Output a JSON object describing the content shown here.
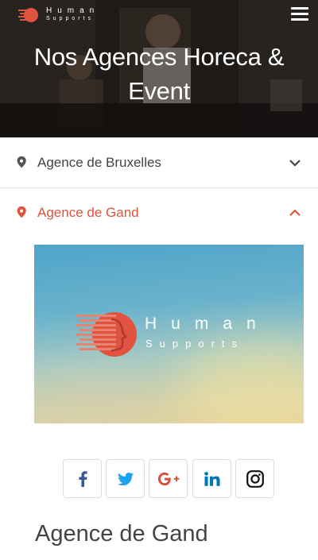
{
  "header": {
    "brand_line1": "Human",
    "brand_line2": "Supports",
    "title_line1": "Nos Agences Horeca &",
    "title_line2": "Event"
  },
  "accordion": [
    {
      "label": "Agence de Bruxelles",
      "state": "collapsed"
    },
    {
      "label": "Agence de Gand",
      "state": "expanded"
    }
  ],
  "panel": {
    "brand_line1": "Human",
    "brand_line2": "Supports"
  },
  "social": [
    {
      "icon": "facebook-icon",
      "color": "#3b5998"
    },
    {
      "icon": "twitter-icon",
      "color": "#1da1f2"
    },
    {
      "icon": "google-plus-icon",
      "color": "#dd4b39"
    },
    {
      "icon": "linkedin-icon",
      "color": "#0077b5"
    },
    {
      "icon": "instagram-icon",
      "color": "#111111"
    }
  ],
  "content": {
    "subtitle": "Agence de Gand"
  },
  "colors": {
    "accent": "#e0533f",
    "text": "#444444",
    "divider": "#e4e4e4"
  }
}
